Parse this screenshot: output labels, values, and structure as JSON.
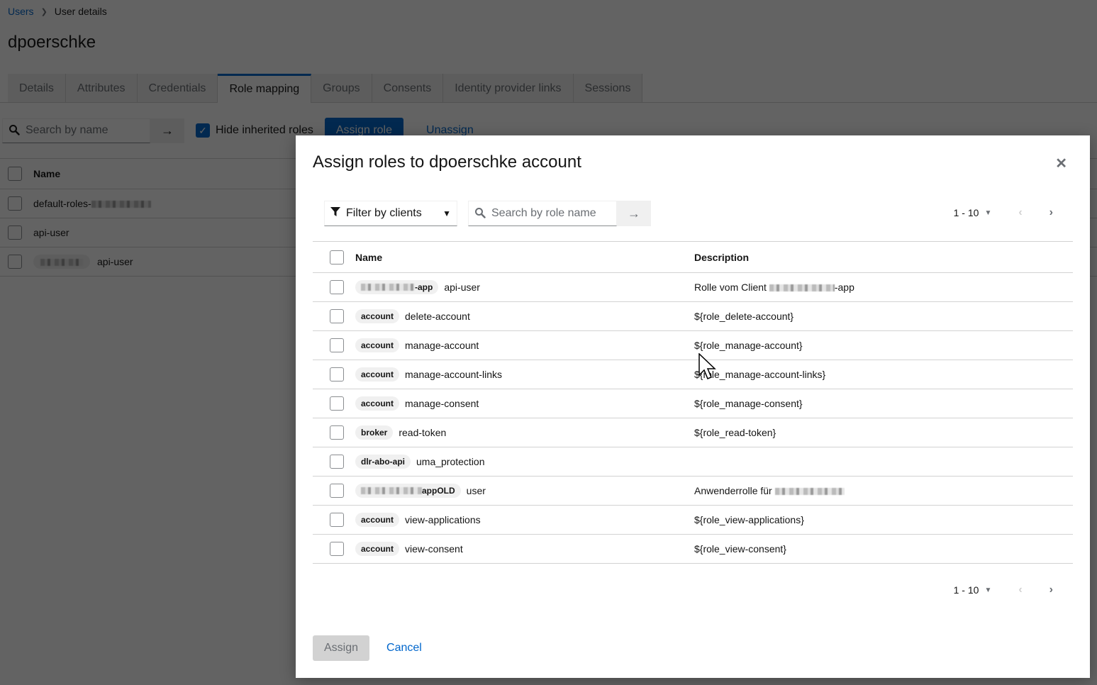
{
  "breadcrumb": {
    "parent": "Users",
    "current": "User details"
  },
  "page_title": "dpoerschke",
  "tabs": [
    {
      "label": "Details",
      "active": false
    },
    {
      "label": "Attributes",
      "active": false
    },
    {
      "label": "Credentials",
      "active": false
    },
    {
      "label": "Role mapping",
      "active": true
    },
    {
      "label": "Groups",
      "active": false
    },
    {
      "label": "Consents",
      "active": false
    },
    {
      "label": "Identity provider links",
      "active": false
    },
    {
      "label": "Sessions",
      "active": false
    }
  ],
  "bg_toolbar": {
    "search_placeholder": "Search by name",
    "hide_inherited_label": "Hide inherited roles",
    "hide_inherited_checked": true,
    "assign_label": "Assign role",
    "unassign_label": "Unassign"
  },
  "bg_table": {
    "header_name": "Name",
    "rows": [
      {
        "name": "default-roles-",
        "client": ""
      },
      {
        "name": "api-user",
        "client": ""
      },
      {
        "name": "api-user",
        "client": "[redacted]"
      }
    ]
  },
  "modal": {
    "title": "Assign roles to dpoerschke account",
    "filter_label": "Filter by clients",
    "search_placeholder": "Search by role name",
    "pagination": {
      "range": "1 - 10"
    },
    "columns": {
      "name": "Name",
      "description": "Description"
    },
    "rows": [
      {
        "client": "-app",
        "client_redacted": true,
        "role": "api-user",
        "description": "Rolle vom Client ",
        "description_suffix": "-app",
        "description_redacted": true
      },
      {
        "client": "account",
        "role": "delete-account",
        "description": "${role_delete-account}"
      },
      {
        "client": "account",
        "role": "manage-account",
        "description": "${role_manage-account}"
      },
      {
        "client": "account",
        "role": "manage-account-links",
        "description": "${role_manage-account-links}"
      },
      {
        "client": "account",
        "role": "manage-consent",
        "description": "${role_manage-consent}"
      },
      {
        "client": "broker",
        "role": "read-token",
        "description": "${role_read-token}"
      },
      {
        "client": "dlr-abo-api",
        "role": "uma_protection",
        "description": ""
      },
      {
        "client": "appOLD",
        "client_redacted": true,
        "role": "user",
        "description": "Anwenderrolle für ",
        "description_suffix": "",
        "description_redacted": true
      },
      {
        "client": "account",
        "role": "view-applications",
        "description": "${role_view-applications}"
      },
      {
        "client": "account",
        "role": "view-consent",
        "description": "${role_view-consent}"
      }
    ],
    "assign_label": "Assign",
    "cancel_label": "Cancel"
  },
  "colors": {
    "primary": "#0066cc",
    "pill_bg": "#f0f0f0",
    "border": "#d2d2d2"
  }
}
